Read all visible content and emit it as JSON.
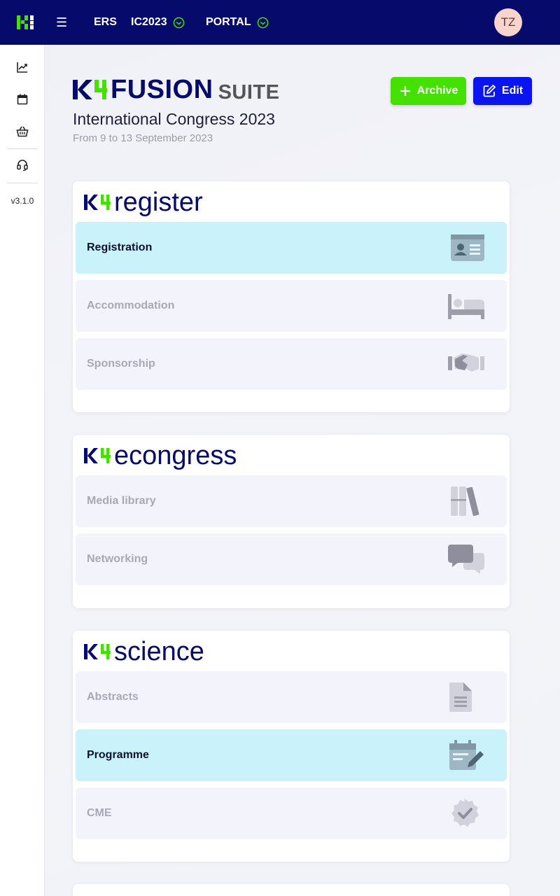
{
  "topbar": {
    "nav": [
      {
        "label": "ERS",
        "checked": false
      },
      {
        "label": "IC2023",
        "checked": true
      },
      {
        "label": "PORTAL",
        "checked": true
      }
    ],
    "avatar_initials": "TZ",
    "colors": {
      "bar": "#050a6b",
      "accent_green": "#44e000"
    }
  },
  "sidebar": {
    "icons": [
      "chart-line-icon",
      "calendar-icon",
      "basket-icon",
      "headset-icon"
    ],
    "version": "v3.1.0"
  },
  "header": {
    "brand_fusion": "FUSION",
    "brand_suite": "SUITE",
    "event_title": "International Congress 2023",
    "event_dates": "From 9 to 13 September 2023",
    "archive_label": "Archive",
    "edit_label": "Edit"
  },
  "cards": [
    {
      "name": "register",
      "modules": [
        {
          "label": "Registration",
          "active": true,
          "icon": "id-card-icon"
        },
        {
          "label": "Accommodation",
          "active": false,
          "icon": "bed-icon"
        },
        {
          "label": "Sponsorship",
          "active": false,
          "icon": "handshake-icon"
        }
      ]
    },
    {
      "name": "econgress",
      "modules": [
        {
          "label": "Media library",
          "active": false,
          "icon": "books-icon"
        },
        {
          "label": "Networking",
          "active": false,
          "icon": "comments-icon"
        }
      ]
    },
    {
      "name": "science",
      "modules": [
        {
          "label": "Abstracts",
          "active": false,
          "icon": "document-icon"
        },
        {
          "label": "Programme",
          "active": true,
          "icon": "calendar-edit-icon"
        },
        {
          "label": "CME",
          "active": false,
          "icon": "certificate-check-icon"
        }
      ]
    }
  ]
}
